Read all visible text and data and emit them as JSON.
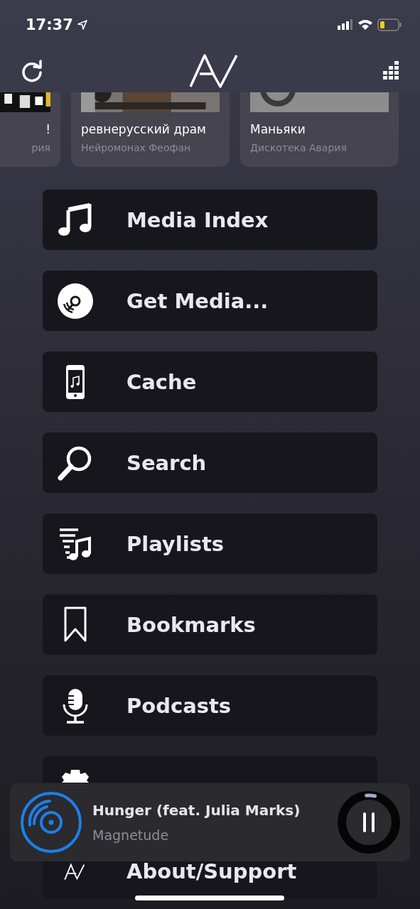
{
  "status_bar": {
    "time": "17:37"
  },
  "carousel": [
    {
      "title": "!",
      "subtitle": "рия"
    },
    {
      "title": "ревнерусский драм",
      "subtitle": "Нейромонах Феофан"
    },
    {
      "title": "Маньяки",
      "subtitle": "Дискотека Авария"
    }
  ],
  "menu": [
    {
      "label": "Media Index",
      "kind": "full"
    },
    {
      "label": "Get Media...",
      "kind": "full"
    },
    {
      "label": "Cache",
      "kind": "full"
    },
    {
      "label": "Search",
      "kind": "full"
    },
    {
      "label": "Playlists",
      "kind": "full"
    },
    {
      "label": "Bookmarks",
      "kind": "full"
    },
    {
      "label": "Podcasts",
      "kind": "full"
    },
    {
      "kind": "top-peek"
    },
    {
      "label": "About/Support",
      "kind": "bottom-peek"
    }
  ],
  "now_playing": {
    "title": "Hunger (feat. Julia Marks)",
    "artist": "Magnetude",
    "level": 0.05
  }
}
